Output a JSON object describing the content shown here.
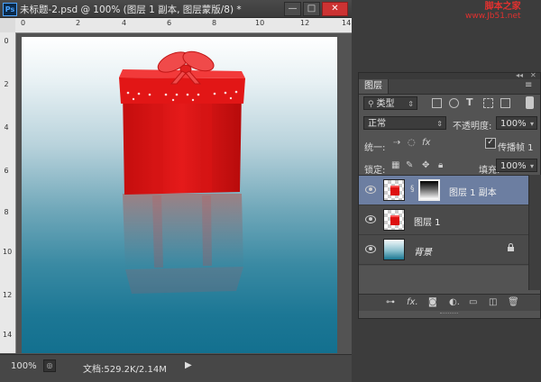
{
  "document": {
    "title": "未标题-2.psd @ 100% (图层 1 副本, 图层蒙版/8) *",
    "app_icon_text": "Ps",
    "window_buttons": {
      "minimize": "—",
      "maximize": "□",
      "close": "✕"
    },
    "ruler_top_numbers": [
      "0",
      "2",
      "4",
      "6",
      "8",
      "10",
      "12",
      "14"
    ],
    "ruler_left_numbers": [
      "0",
      "2",
      "4",
      "6",
      "8",
      "10",
      "12",
      "14"
    ],
    "status": {
      "zoom": "100%",
      "doc_info": "文档:529.2K/2.14M",
      "arrow": "▶"
    }
  },
  "layers_panel": {
    "tab_label": "图层",
    "menu_icon": "≡",
    "collapse_icon": "◂◂",
    "close_icon": "✕",
    "filter_kind": "类型",
    "filter_icons": [
      "image-filter-icon",
      "adjustment-filter-icon",
      "type-filter-icon",
      "shape-filter-icon",
      "smart-object-filter-icon"
    ],
    "blend_mode": "正常",
    "opacity_label": "不透明度:",
    "opacity_value": "100%",
    "unify_label": "统一:",
    "propagate_label": "传播帧 1",
    "propagate_checked": true,
    "lock_label": "锁定:",
    "fill_label": "填充:",
    "fill_value": "100%",
    "layers": [
      {
        "name": "图层 1 副本",
        "visible": true,
        "selected": true,
        "has_mask": true
      },
      {
        "name": "图层 1",
        "visible": true,
        "selected": false,
        "has_mask": false
      },
      {
        "name": "背景",
        "visible": true,
        "selected": false,
        "locked": true,
        "italic": true
      }
    ],
    "bottom_icons": [
      "link-layers-icon",
      "fx-icon",
      "add-mask-icon",
      "adjustment-layer-icon",
      "new-group-icon",
      "new-layer-icon",
      "delete-layer-icon"
    ]
  },
  "watermark": {
    "title": "脚本之家",
    "url": "www.Jb51.net"
  },
  "colors": {
    "selected_layer": "#6c7ea1",
    "gift_red": "#e01818",
    "close_button": "#cc3333"
  }
}
